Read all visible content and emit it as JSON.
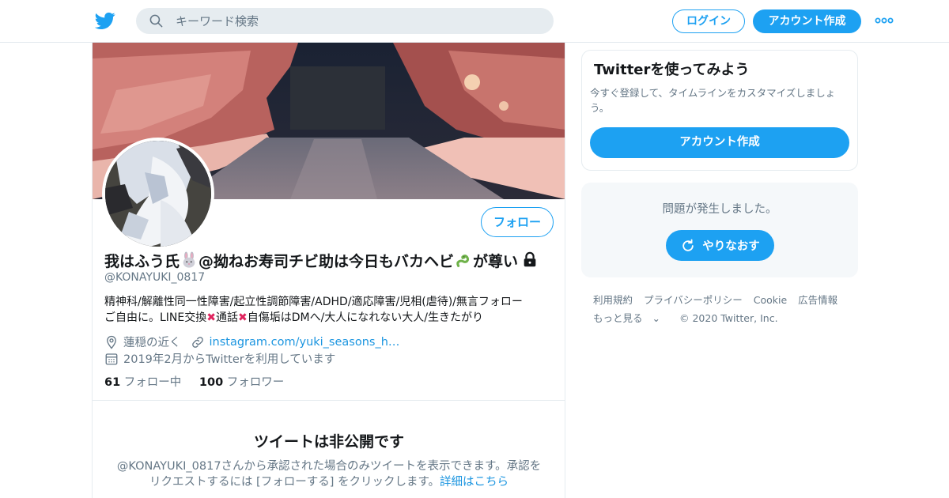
{
  "header": {
    "search_placeholder": "キーワード検索",
    "login_label": "ログイン",
    "signup_label": "アカウント作成",
    "more_icon": "more-dots-icon"
  },
  "profile": {
    "display_name_part1": "我はふう氏",
    "display_name_part2": "@拗ねお寿司チビ助は今日もバカヘビ",
    "display_name_part3": "が尊い",
    "handle": "@KONAYUKI_0817",
    "follow_label": "フォロー",
    "bio_line1": "精神科/解離性同一性障害/起立性調節障害/ADHD/適応障害/児相(虐待)/無言フォロー",
    "bio_line2": "ご自由に。LINE交換",
    "bio_line2b": "通話",
    "bio_line2c": "自傷垢はDMへ/大人になれない大人/生きたがり",
    "location": "蓮穏の近く",
    "website": "instagram.com/yuki_seasons_h…",
    "joined": "2019年2月からTwitterを利用しています",
    "following_count": "61",
    "following_label": "フォロー中",
    "followers_count": "100",
    "followers_label": "フォロワー"
  },
  "private_notice": {
    "title": "ツイートは非公開です",
    "body_line1": "@KONAYUKI_0817さんから承認された場合のみツイートを表示できます。承認を",
    "body_line2": "リクエストするには [フォローする] をクリックします。",
    "learn_more": "詳細はこちら"
  },
  "signup_card": {
    "title": "Twitterを使ってみよう",
    "description": "今すぐ登録して、タイムラインをカスタマイズしましょう。",
    "button_label": "アカウント作成"
  },
  "error_card": {
    "message": "問題が発生しました。",
    "retry_label": "やりなおす"
  },
  "footer": {
    "links": [
      "利用規約",
      "プライバシーポリシー",
      "Cookie",
      "広告情報",
      "もっと見る"
    ],
    "copyright": "© 2020 Twitter, Inc."
  },
  "colors": {
    "brand": "#1da1f2",
    "link": "#1b95e0",
    "muted_text": "#657786",
    "search_bg": "#e6ecf0",
    "cross_mark": "#e0245e"
  }
}
